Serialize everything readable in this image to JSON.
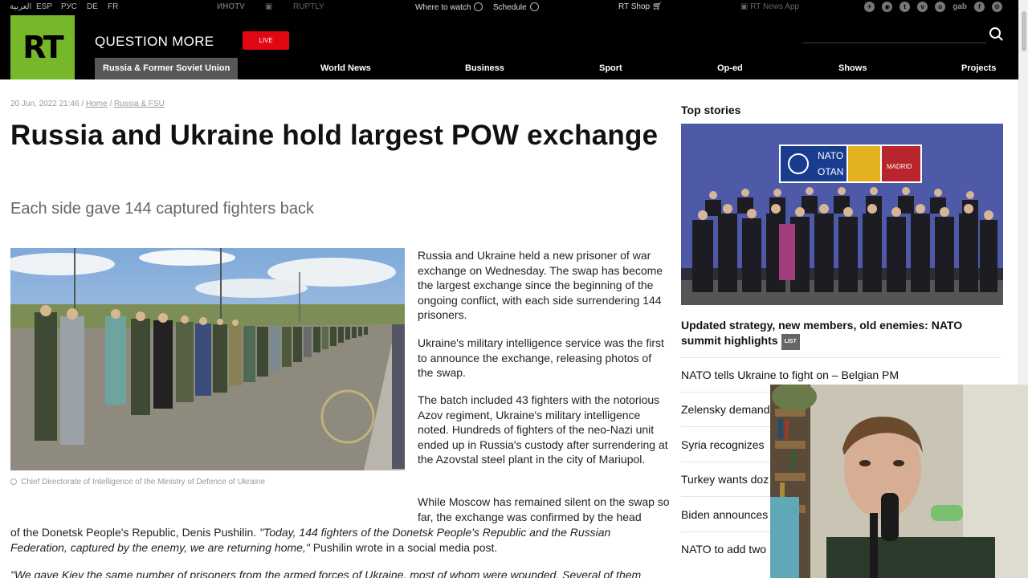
{
  "topbar": {
    "languages": [
      "العربية",
      "ESP",
      "РУС",
      "DE",
      "FR"
    ],
    "partners": [
      "ИНОТV",
      "RUPTLY"
    ],
    "where_to_watch": "Where to watch",
    "schedule": "Schedule",
    "shop": "RT Shop",
    "app": "RT News App",
    "social_gab": "gab"
  },
  "header": {
    "logo": "RT",
    "slogan": "QUESTION MORE",
    "live": "LIVE"
  },
  "nav": [
    "Russia & Former Soviet Union",
    "World News",
    "Business",
    "Sport",
    "Op-ed",
    "Shows",
    "Projects"
  ],
  "article": {
    "date": "20 Jun, 2022 21:46",
    "breadcrumb": [
      "Home",
      "Russia & FSU"
    ],
    "title": "Russia and Ukraine hold largest POW exchange",
    "subtitle": "Each side gave 144 captured fighters back",
    "caption": "Chief Directorate of Intelligence of the Ministry of Defence of Ukraine",
    "p1": "Russia and Ukraine held a new prisoner of war exchange on Wednesday. The swap has become the largest exchange since the beginning of the ongoing conflict, with each side surrendering 144 prisoners.",
    "p2": "Ukraine's military intelligence service was the first to announce the exchange, releasing photos of the swap.",
    "p3": "The batch included 43 fighters with the notorious Azov regiment, Ukraine's military intelligence noted. Hundreds of fighters of the neo-Nazi unit ended up in Russia's custody after surrendering at the Azovstal steel plant in the city of Mariupol.",
    "p4a": "While Moscow has remained silent on the swap so far, the exchange was confirmed by the head",
    "p4b": "of the Donetsk People's Republic, Denis Pushilin.",
    "p4quote": "\"Today, 144 fighters of the Donetsk People's Republic and the Russian Federation, captured by the enemy, we are returning home,\"",
    "p4c": "Pushilin wrote in a social media post.",
    "p5": "\"We gave Kiev the same number of prisoners from the armed forces of Ukraine, most of whom were wounded. Several of them"
  },
  "sidebar": {
    "title": "Top stories",
    "lead": "Updated strategy, new members, old enemies: NATO summit highlights",
    "lead_badge": "LIST",
    "stories": [
      "NATO tells Ukraine to fight on – Belgian PM",
      "Zelensky demand",
      "Syria recognizes",
      "Turkey wants doz",
      "Biden announces",
      "NATO to add two"
    ],
    "banner_left": "NATO",
    "banner_left2": "OTAN",
    "banner_right": "MADRID"
  },
  "colors": {
    "brand_green": "#77b82a",
    "live_red": "#e30613"
  }
}
